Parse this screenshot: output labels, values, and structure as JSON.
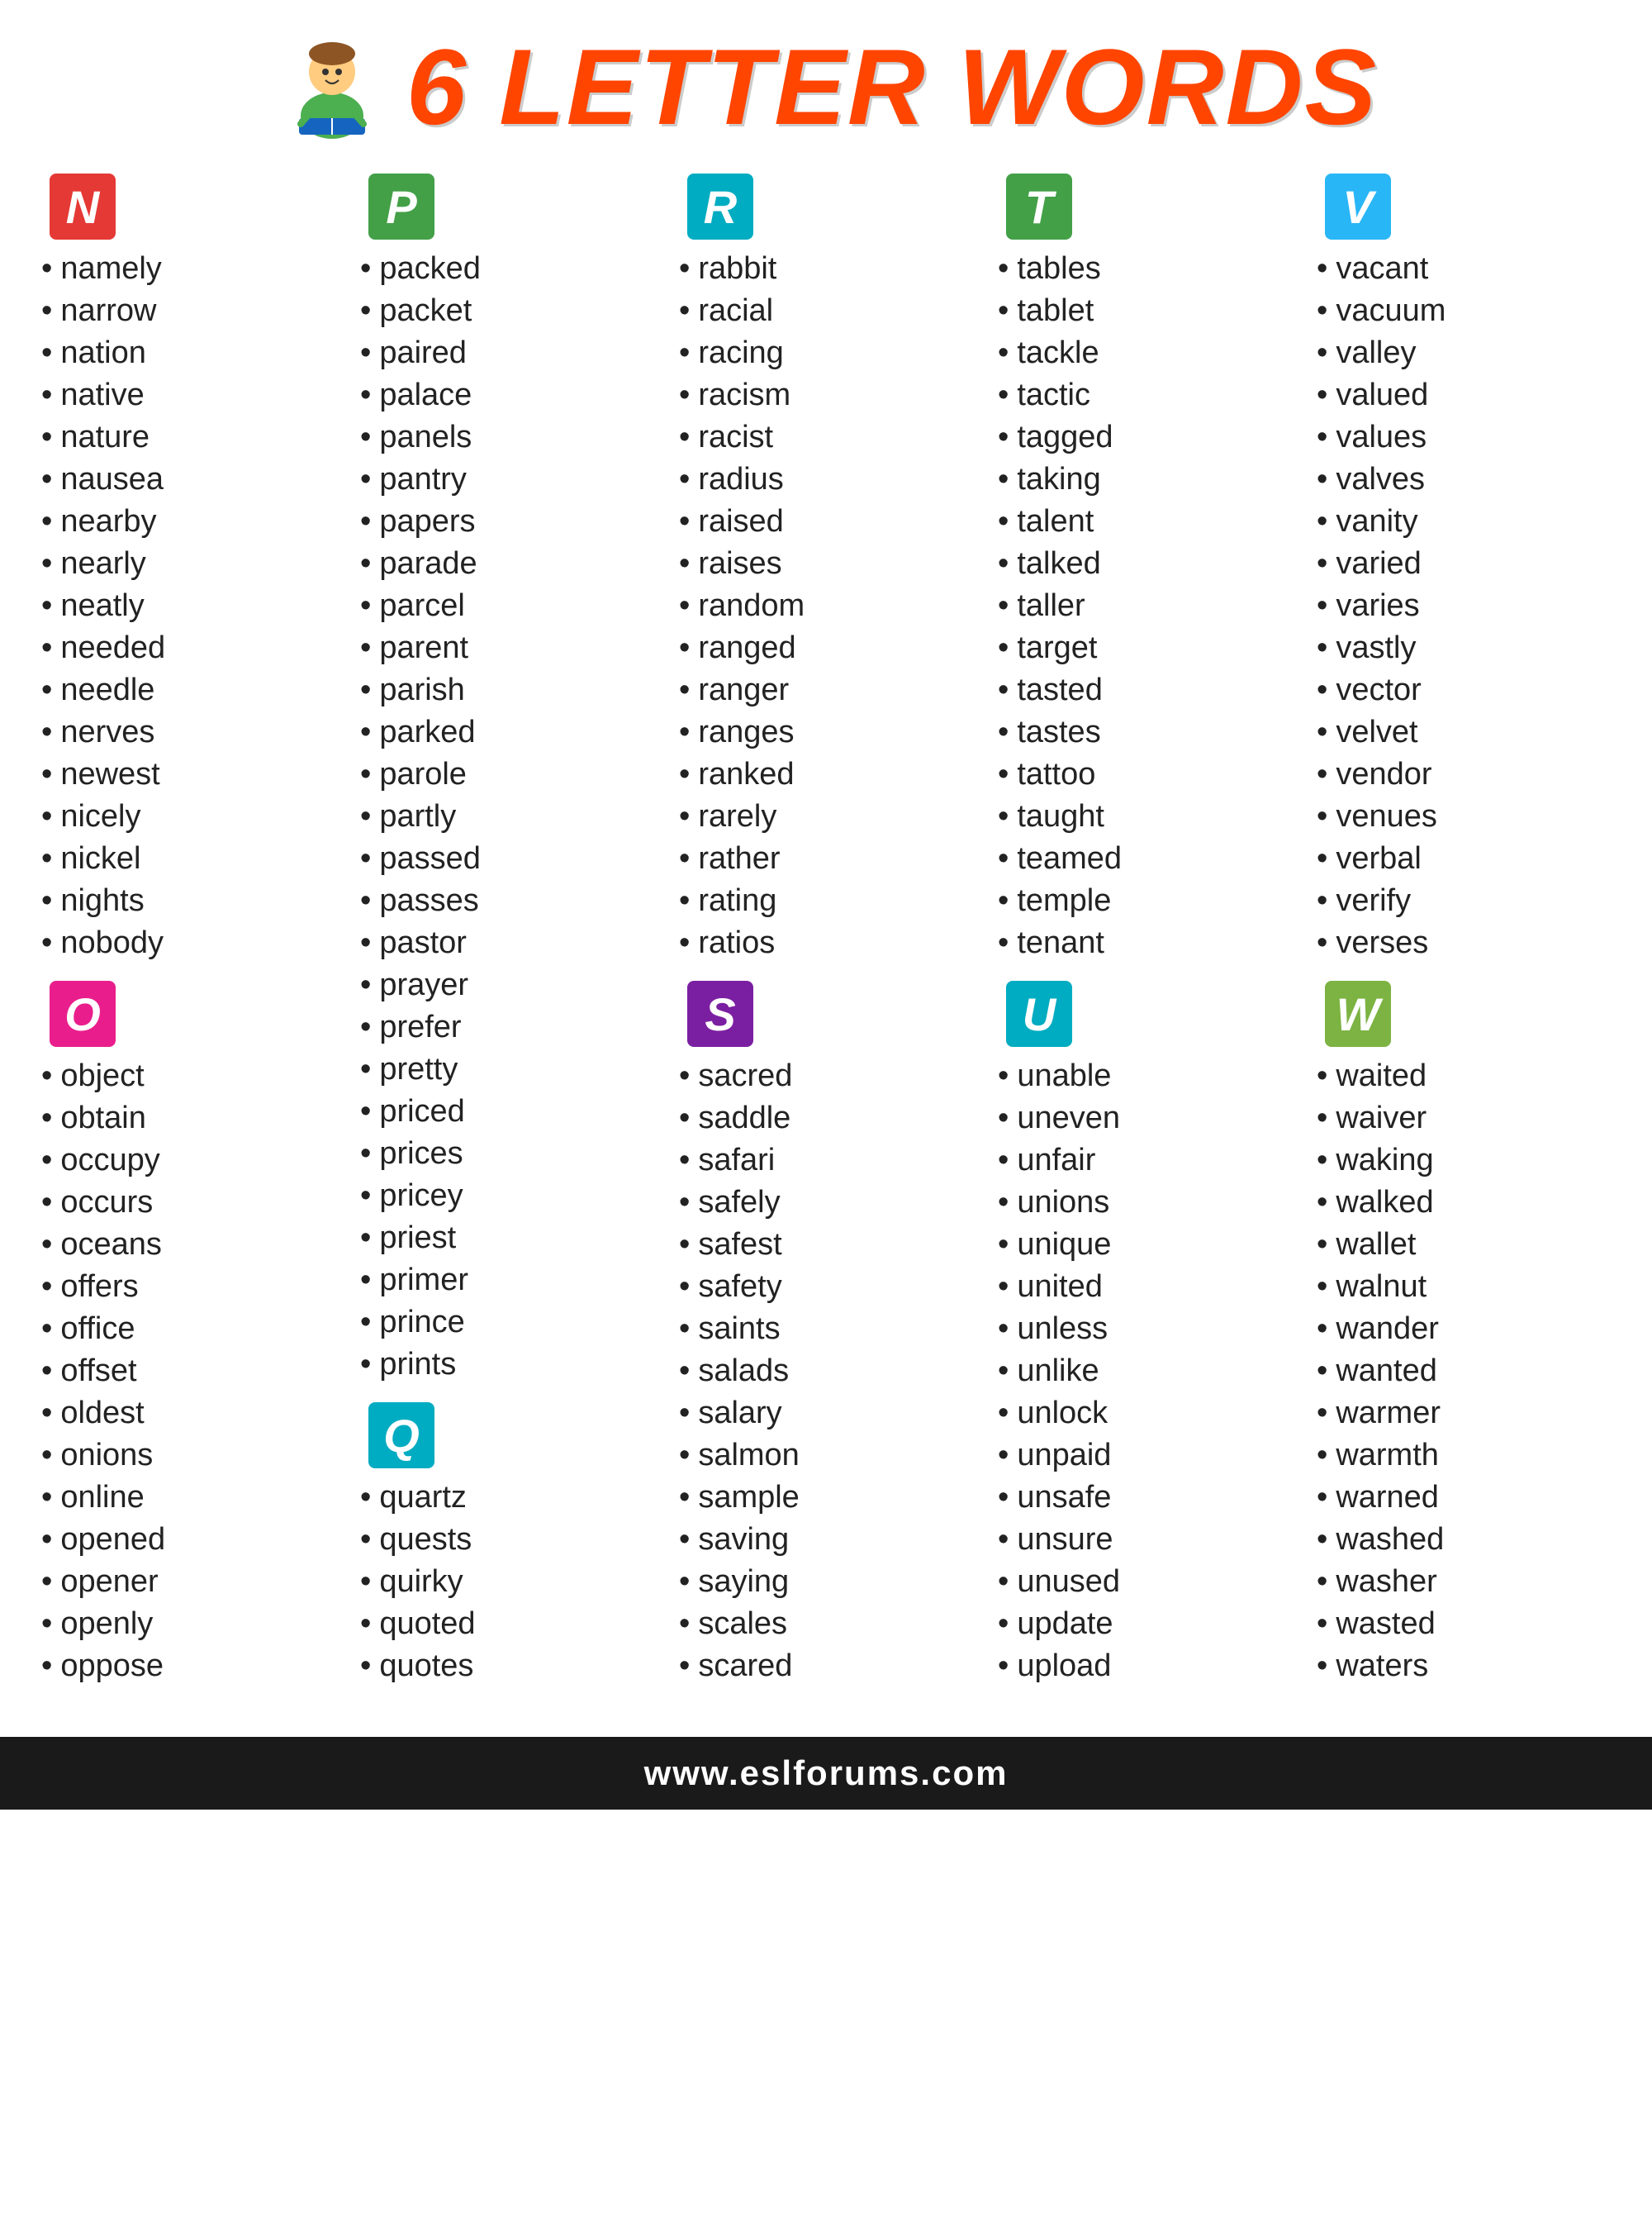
{
  "header": {
    "title": "6 LETTER WORDS",
    "website": "www.eslforums.com"
  },
  "colors": {
    "N": "#E53935",
    "P": "#43A047",
    "R": "#00ACC1",
    "T": "#43A047",
    "V": "#29B6F6",
    "O": "#E91E8C",
    "Q": "#00ACC1",
    "S": "#7B1FA2",
    "U": "#00ACC1",
    "W": "#7CB342"
  },
  "sections": [
    {
      "letter": "N",
      "color": "#E53935",
      "words": [
        "namely",
        "narrow",
        "nation",
        "native",
        "nature",
        "nausea",
        "nearby",
        "nearly",
        "neatly",
        "needed",
        "needle",
        "nerves",
        "newest",
        "nicely",
        "nickel",
        "nights",
        "nobody"
      ]
    },
    {
      "letter": "P",
      "color": "#43A047",
      "words": [
        "packed",
        "packet",
        "paired",
        "palace",
        "panels",
        "pantry",
        "papers",
        "parade",
        "parcel",
        "parent",
        "parish",
        "parked",
        "parole",
        "partly",
        "passed",
        "passes",
        "pastor",
        "prayer",
        "prefer",
        "pretty",
        "priced",
        "prices",
        "pricey",
        "priest",
        "primer",
        "prince",
        "prints"
      ]
    },
    {
      "letter": "R",
      "color": "#00ACC1",
      "words": [
        "rabbit",
        "racial",
        "racing",
        "racism",
        "racist",
        "radius",
        "raised",
        "raises",
        "random",
        "ranged",
        "ranger",
        "ranges",
        "ranked",
        "rarely",
        "rather",
        "rating",
        "ratios"
      ]
    },
    {
      "letter": "T",
      "color": "#43A047",
      "words": [
        "tables",
        "tablet",
        "tackle",
        "tactic",
        "tagged",
        "taking",
        "talent",
        "talked",
        "taller",
        "target",
        "tasted",
        "tastes",
        "tattoo",
        "taught",
        "teamed",
        "temple",
        "tenant"
      ]
    },
    {
      "letter": "V",
      "color": "#29B6F6",
      "words": [
        "vacant",
        "vacuum",
        "valley",
        "valued",
        "values",
        "valves",
        "vanity",
        "varied",
        "varies",
        "vastly",
        "vector",
        "velvet",
        "vendor",
        "venues",
        "verbal",
        "verify",
        "verses"
      ]
    },
    {
      "letter": "O",
      "color": "#E91E8C",
      "words": [
        "object",
        "obtain",
        "occupy",
        "occurs",
        "oceans",
        "offers",
        "office",
        "offset",
        "oldest",
        "onions",
        "online",
        "opened",
        "opener",
        "openly",
        "oppose"
      ]
    },
    {
      "letter": "Q",
      "color": "#00ACC1",
      "words": [
        "quartz",
        "quests",
        "quirky",
        "quoted",
        "quotes"
      ]
    },
    {
      "letter": "S",
      "color": "#7B1FA2",
      "words": [
        "sacred",
        "saddle",
        "safari",
        "safely",
        "safest",
        "safety",
        "saints",
        "salads",
        "salary",
        "salmon",
        "sample",
        "saving",
        "saying",
        "scales",
        "scared"
      ]
    },
    {
      "letter": "U",
      "color": "#00ACC1",
      "words": [
        "unable",
        "uneven",
        "unfair",
        "unions",
        "unique",
        "united",
        "unless",
        "unlike",
        "unlock",
        "unpaid",
        "unsafe",
        "unsure",
        "unused",
        "update",
        "upload"
      ]
    },
    {
      "letter": "W",
      "color": "#7CB342",
      "words": [
        "waited",
        "waiver",
        "waking",
        "walked",
        "wallet",
        "walnut",
        "wander",
        "wanted",
        "warmer",
        "warmth",
        "warned",
        "washed",
        "washer",
        "wasted",
        "waters"
      ]
    }
  ]
}
